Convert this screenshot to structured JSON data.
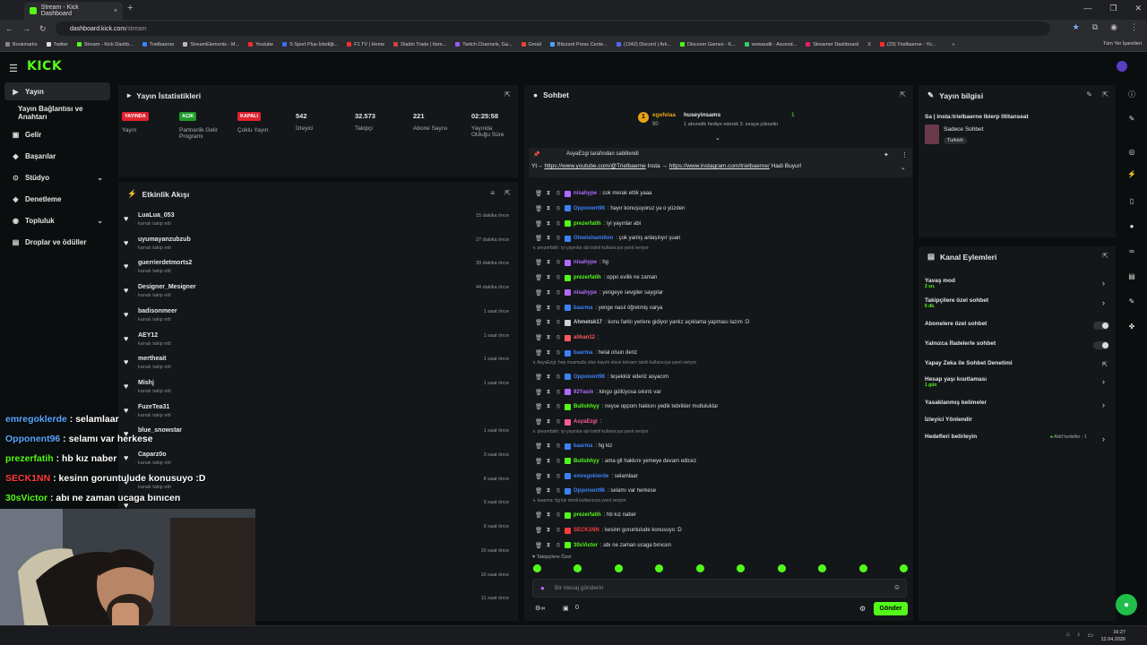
{
  "browser": {
    "tab_title": "Stream - Kick Dashboard",
    "tab_close": "×",
    "new_tab": "+",
    "window_controls": [
      "—",
      "❐",
      "✕"
    ],
    "url_host": "dashboard.kick.com",
    "url_path": "/stream",
    "bookmarks": [
      "Bookmarks",
      "Twitter",
      "Stream - Kick Dashb...",
      "Trielbaerne",
      "StreamElements - M...",
      "Youtube",
      "S Sport Plus-İzlediği...",
      "F1 TV | Home",
      "Diablo Trade | Item...",
      "Twitch Channels, Ga...",
      "Gmail",
      "Blizzard Press Cente...",
      "(1342) Discord | Ark...",
      "Discover Games - K...",
      "wowaudit - Ascend...",
      "Streamer Dashboard",
      "X",
      "(23) Trielbaerne - Yo..."
    ],
    "bookmarks_more": "»",
    "all_bookmarks": "Tüm Yer İşaretleri"
  },
  "kick": {
    "logo": "KICK",
    "nav": [
      {
        "label": "Yayın",
        "icon": "▶"
      },
      {
        "label": "Yayın Bağlantısı ve Anahtarı",
        "icon": ""
      },
      {
        "label": "Gelir",
        "icon": "▣"
      },
      {
        "label": "Başarılar",
        "icon": "◆"
      },
      {
        "label": "Stüdyo",
        "icon": "⊙",
        "chevron": "⌄"
      },
      {
        "label": "Denetleme",
        "icon": "◈"
      },
      {
        "label": "Topluluk",
        "icon": "◉",
        "chevron": "⌄"
      },
      {
        "label": "Droplar ve ödüller",
        "icon": "▤"
      }
    ]
  },
  "stats": {
    "title": "Yayın İstatistikleri",
    "items": [
      {
        "badge": "YAYINDA",
        "badge_color": "#e0222f",
        "label": "Yayın"
      },
      {
        "badge": "AÇIK",
        "badge_color": "#1f9a2a",
        "label": "Partnerlik Gelir Programı"
      },
      {
        "badge": "KAPALI",
        "badge_color": "#e0222f",
        "label": "Çoklu Yayın"
      },
      {
        "value": "542",
        "label": "İzleyici"
      },
      {
        "value": "32.573",
        "label": "Takipçi"
      },
      {
        "value": "221",
        "label": "Abone Sayısı"
      },
      {
        "value": "02:25:58",
        "label": "Yayında Olduğu Süre"
      }
    ]
  },
  "activity": {
    "title": "Etkinlik Akışı",
    "items": [
      {
        "name": "LuaLua_053",
        "sub": "kanalı takip etti",
        "time": "15 dakika önce"
      },
      {
        "name": "uyumayanzubzub",
        "sub": "kanalı takip etti",
        "time": "27 dakika önce"
      },
      {
        "name": "guerrierdetmorts2",
        "sub": "kanalı takip etti",
        "time": "39 dakika önce"
      },
      {
        "name": "Designer_Mesigner",
        "sub": "kanalı takip etti",
        "time": "44 dakika önce"
      },
      {
        "name": "badisonmeer",
        "sub": "kanalı takip etti",
        "time": "1 saat önce"
      },
      {
        "name": "AEY12",
        "sub": "kanalı takip etti",
        "time": "1 saat önce"
      },
      {
        "name": "mertheait",
        "sub": "kanalı takip etti",
        "time": "1 saat önce"
      },
      {
        "name": "Mishj",
        "sub": "kanalı takip etti",
        "time": "1 saat önce"
      },
      {
        "name": "FuzeTea31",
        "sub": "kanalı takip etti",
        "time": ""
      },
      {
        "name": "blue_snowstar",
        "sub": "",
        "time": "1 saat önce"
      },
      {
        "name": "Caparz0o",
        "sub": "kanalı takip etti",
        "time": "3 saat önce"
      },
      {
        "name": "",
        "sub": "kanalı takip etti",
        "time": "8 saat önce"
      },
      {
        "name": "",
        "sub": "",
        "time": "9 saat önce"
      },
      {
        "name": "",
        "sub": "",
        "time": "9 saat önce"
      },
      {
        "name": "",
        "sub": "",
        "time": "10 saat önce"
      },
      {
        "name": "",
        "sub": "",
        "time": "10 saat önce"
      },
      {
        "name": "",
        "sub": "",
        "time": "11 saat önce"
      }
    ]
  },
  "chat": {
    "title": "Sohbet",
    "top_gifter": {
      "name": "egefelaa",
      "count": "90",
      "rank": "1"
    },
    "top_sub": {
      "name": "huseyinsams",
      "count": "1",
      "note": "1 abonelik hediye ederek 3. sıraya yükselin"
    },
    "pinned_by": "AsyaEzgi tarafından sabitlendi",
    "pinned_text_pre": "Yt→ ",
    "pinned_link1": "https://www.youtube.com/@Trielbaerne",
    "pinned_mid": " Insta → ",
    "pinned_link2": "https://www.instagram.com/trielbaerne/",
    "pinned_end": " Hadi Buyur!",
    "messages": [
      {
        "user": "nisahype",
        "color": "#b26bff",
        "text": ": cok merak ettik yaaa"
      },
      {
        "user": "Opponent96",
        "color": "#3b82f6",
        "text": ": hayır konuşuyoruz ya o yüzden"
      },
      {
        "user": "prezerfatih",
        "color": "#53fc18",
        "text": ": iyi yayınlar abi"
      },
      {
        "user": "Olewishamilton",
        "color": "#3b82f6",
        "text": ": çok yanlış anlaşılıyır şuan"
      },
      {
        "reply": "prezerfatih: iyi yayınlar abi isimli kullanıcıya yanıt veriyor"
      },
      {
        "user": "nisahype",
        "color": "#b26bff",
        "text": ": hg"
      },
      {
        "user": "prezerfatih",
        "color": "#53fc18",
        "text": ": oppo evilik ne zaman"
      },
      {
        "user": "nisahype",
        "color": "#b26bff",
        "text": ": yengeye sevgiler saygılar"
      },
      {
        "user": "baarma",
        "color": "#3b82f6",
        "text": ": yenge nasıl öğretmiş varya"
      },
      {
        "user": "Ahmetsk17",
        "color": "#d0d0d0",
        "text": ": konu farklı yerlere gidiyor yanlız açıklama yapması lazım :D"
      },
      {
        "user": "alihan12",
        "color": "#ff5a5a",
        "text": ":"
      },
      {
        "user": "baarma",
        "color": "#3b82f6",
        "text": ": helal olsun deriz"
      },
      {
        "reply": "AsyaEzgi: hep musmutlu olun hayırlı olsun tekrarrr isimli kullanıcıya yanıt veriyor"
      },
      {
        "user": "Opponent96",
        "color": "#3b82f6",
        "text": ": teşekkür ederiz asyacım"
      },
      {
        "user": "92Yasin",
        "color": "#b26bff",
        "text": ": kingo güllüyosa sıkıntı var"
      },
      {
        "user": "Bullshhyy",
        "color": "#53fc18",
        "text": ": neyse oppom hakkını yedik tebrikler mutluluklar"
      },
      {
        "user": "AsyaEzgi",
        "color": "#ff5a9a",
        "text": ":"
      },
      {
        "reply": "prezerfatih: iyi yayınlar abi isimli kullanıcıya yanıt veriyor"
      },
      {
        "user": "baarma",
        "color": "#3b82f6",
        "text": ": hg kiz"
      },
      {
        "user": "Bullshhyy",
        "color": "#53fc18",
        "text": ": ama git hakkını yemeye devam edicez"
      },
      {
        "user": "emregoklerde",
        "color": "#3b82f6",
        "text": ": selamlaar"
      },
      {
        "user": "Opponent96",
        "color": "#3b82f6",
        "text": ": selamı var herkese"
      },
      {
        "reply": "baarma: hg kiz isimli kullanıcıya yanıt veriyor"
      },
      {
        "user": "prezerfatih",
        "color": "#53fc18",
        "text": ": hb kız naber"
      },
      {
        "user": "SECK1NN",
        "color": "#ff3b3b",
        "text": ": kesinn goruntulude konusuyo :D"
      },
      {
        "user": "30sVictor",
        "color": "#53fc18",
        "text": ": abı ne zaman ucaga bınıcen"
      }
    ],
    "followers_only": "Takipçilere Özel",
    "input_placeholder": "Bir mesaj gönderin",
    "send": "Gönder",
    "viewer_count": "0"
  },
  "info": {
    "title": "Yayın bilgisi",
    "stream_title": "Sa | insta:trielbaerne lbierp lltitanseat",
    "mode": "Sadece Sohbet",
    "language": "Turkish"
  },
  "actions": {
    "title": "Kanal Eylemleri",
    "items": [
      {
        "label": "Yavaş mod",
        "sub": "2 sn.",
        "control": "chevron"
      },
      {
        "label": "Takipçilere özel sohbet",
        "sub": "6 dk.",
        "control": "chevron"
      },
      {
        "label": "Abonelere özel sohbet",
        "sub": "",
        "control": "toggle"
      },
      {
        "label": "Yalnızca İfadelerle sohbet",
        "sub": "",
        "control": "toggle"
      },
      {
        "label": "Yapay Zeka ile Sohbet Denetimi",
        "sub": "",
        "control": "external"
      },
      {
        "label": "Hesap yaşı kısıtlaması",
        "sub": "1 gün",
        "control": "chevron"
      },
      {
        "label": "Yasaklanmış kelimeler",
        "sub": "",
        "control": "chevron"
      },
      {
        "label": "İzleyici Yönlendir",
        "sub": "",
        "control": "none"
      },
      {
        "label": "Hedefleri belirleyin",
        "sub": "",
        "control": "chevron",
        "badge": "Aktif hedefler - 1"
      }
    ]
  },
  "overlay": [
    {
      "user": "emregoklerde",
      "color": "#5aa6ff",
      "text": " : selamlaar"
    },
    {
      "user": "Opponent96",
      "color": "#5aa6ff",
      "text": " : selamı var herkese"
    },
    {
      "user": "prezerfatih",
      "color": "#53fc18",
      "text": " : hb kız naber"
    },
    {
      "user": "SECK1NN",
      "color": "#ff3b3b",
      "text": " : kesinn goruntulude konusuyo :D"
    },
    {
      "user": "30sVictor",
      "color": "#53fc18",
      "text": " : abı ne zaman ucaga bınıcen"
    }
  ],
  "taskbar": {
    "time": "16:27",
    "date": "12.04.2026"
  }
}
